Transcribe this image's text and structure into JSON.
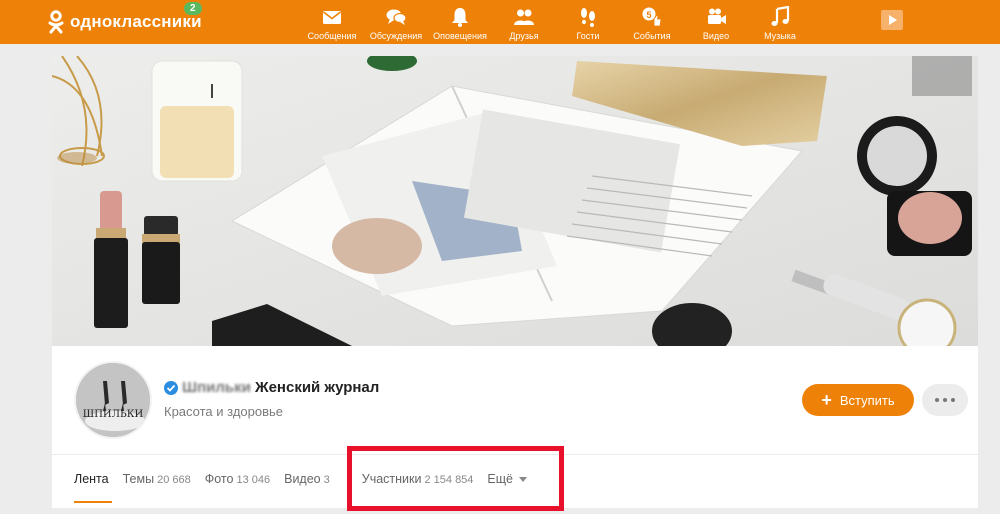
{
  "header": {
    "logo_text": "одноклассники",
    "notifications_badge": "2",
    "nav": [
      {
        "label": "Сообщения",
        "icon": "envelope-icon"
      },
      {
        "label": "Обсуждения",
        "icon": "chat-bubbles-icon"
      },
      {
        "label": "Оповещения",
        "icon": "bell-icon"
      },
      {
        "label": "Друзья",
        "icon": "friends-icon"
      },
      {
        "label": "Гости",
        "icon": "footprints-icon"
      },
      {
        "label": "События",
        "icon": "thumbs-up-five-icon"
      },
      {
        "label": "Видео",
        "icon": "video-camera-icon"
      },
      {
        "label": "Музыка",
        "icon": "music-note-icon"
      }
    ],
    "colors": {
      "brand": "#ee8208"
    }
  },
  "group": {
    "avatar_text": "ШПИЛЬКИ",
    "title_hidden": "Шпильки",
    "title": "Женский журнал",
    "category": "Красота и здоровье",
    "join_label": "Вступить",
    "join_icon": "plus-icon",
    "more_icon": "ellipsis-icon"
  },
  "tabs": [
    {
      "label": "Лента",
      "count": ""
    },
    {
      "label": "Темы",
      "count": "20 668"
    },
    {
      "label": "Фото",
      "count": "13 046"
    },
    {
      "label": "Видео",
      "count": "3"
    },
    {
      "label": "Участники",
      "count": "2 154 854"
    },
    {
      "label": "Ещё",
      "count": ""
    }
  ],
  "annotation": {
    "color": "#e8102a"
  }
}
